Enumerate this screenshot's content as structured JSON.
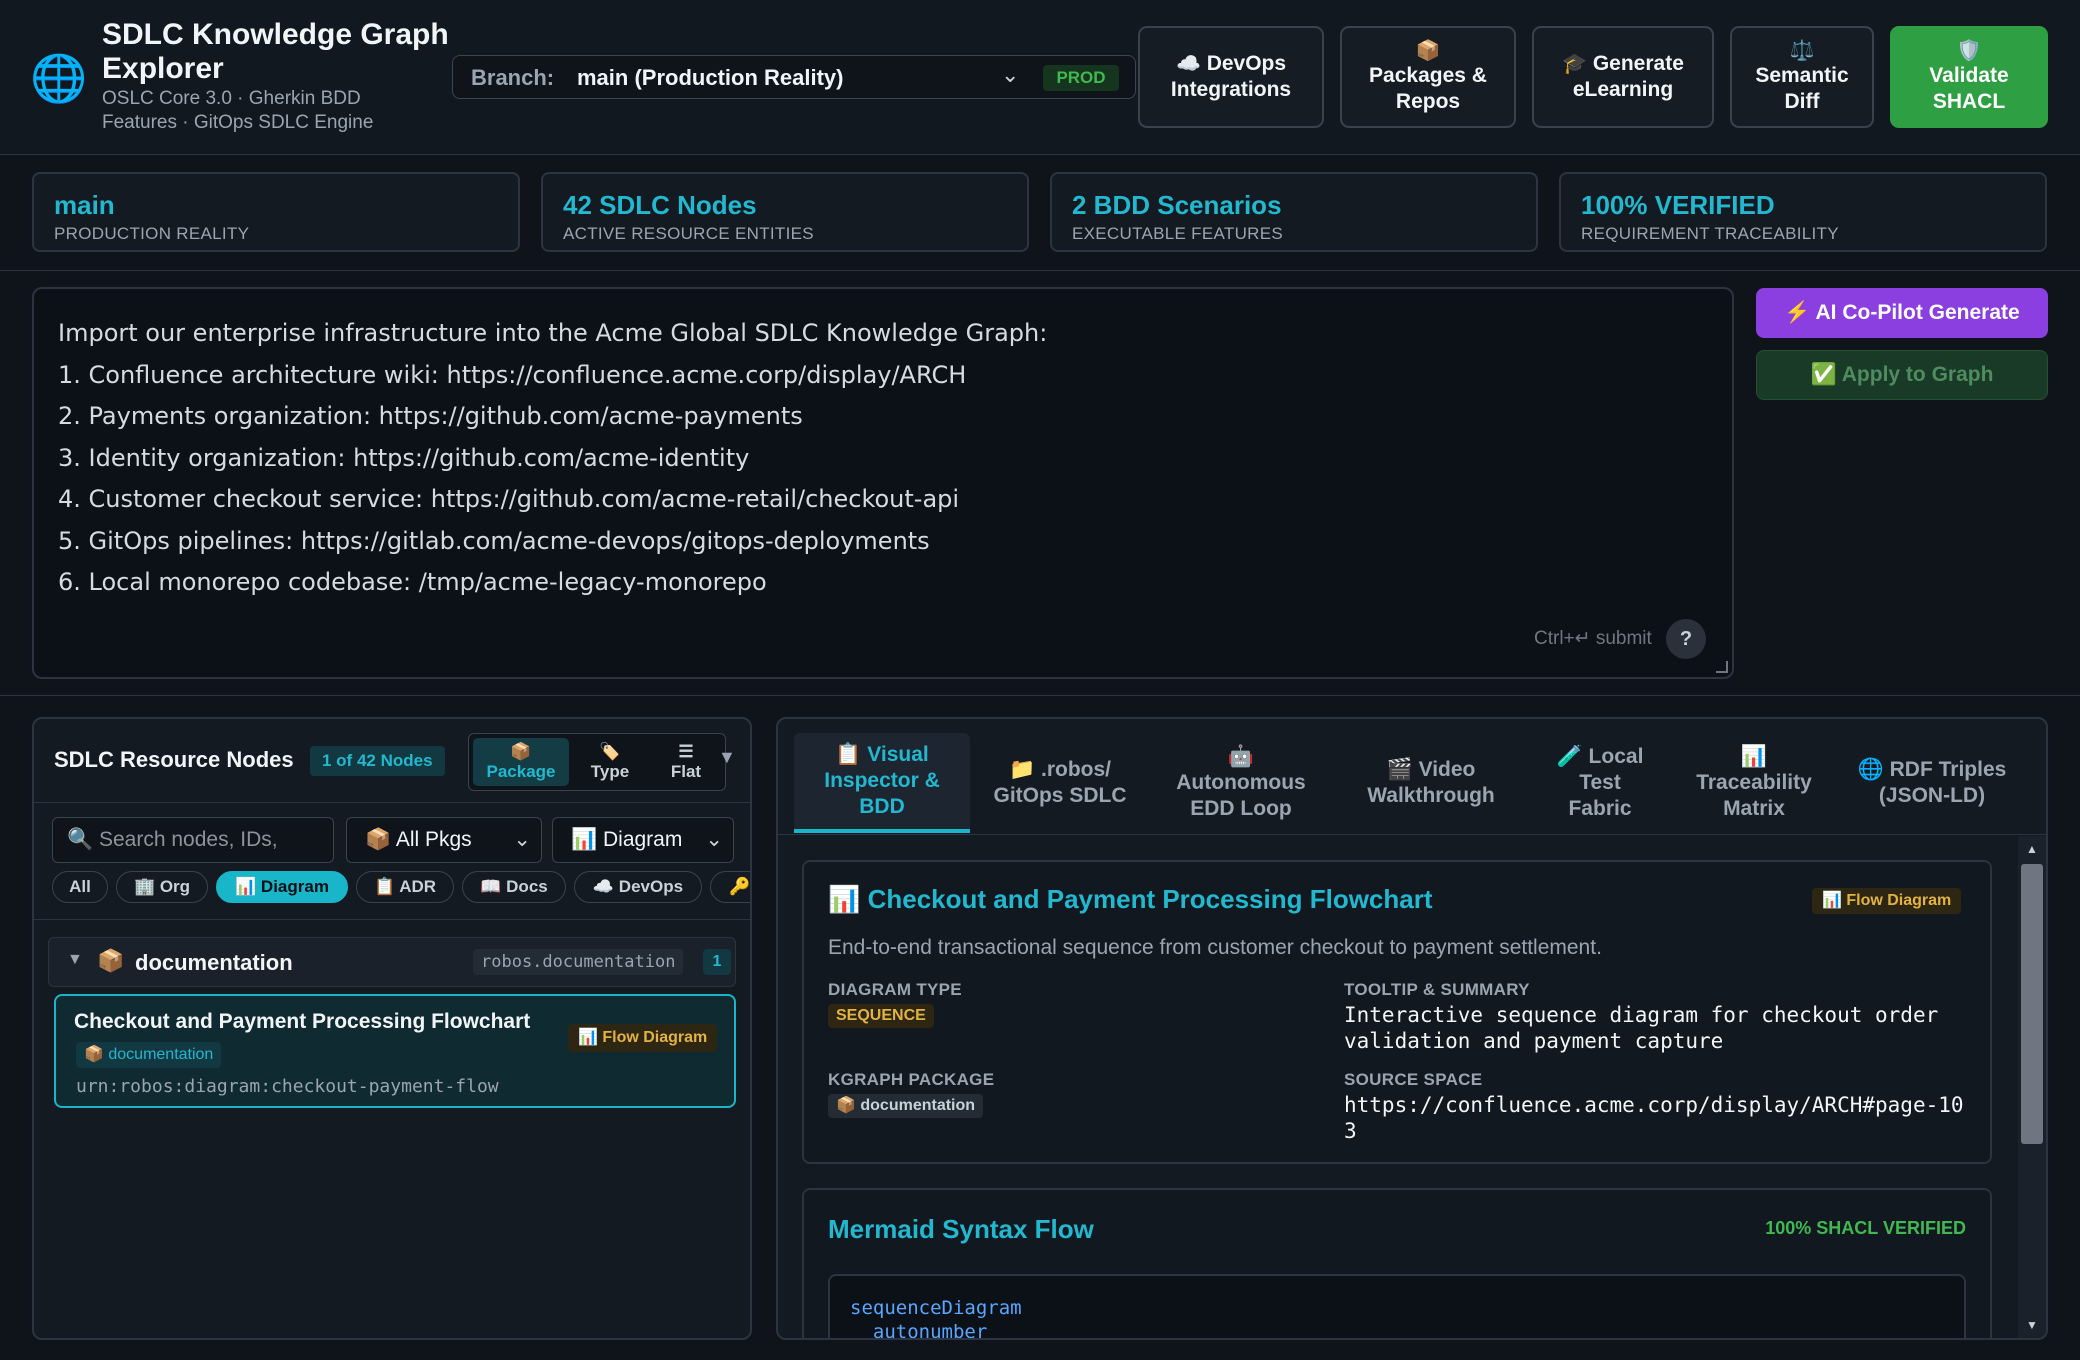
{
  "header": {
    "icon": "globe-icon",
    "title": "SDLC Knowledge Graph Explorer",
    "subtitle": "OSLC Core 3.0 · Gherkin BDD Features · GitOps SDLC Engine",
    "branch": {
      "label": "Branch:",
      "value": "main (Production Reality)",
      "badge": "PROD"
    },
    "buttons": [
      {
        "icon": "☁️",
        "label": "DevOps Integrations"
      },
      {
        "icon": "📦",
        "label": "Packages & Repos"
      },
      {
        "icon": "🎓",
        "label": "Generate eLearning"
      },
      {
        "icon": "⚖️",
        "label": "Semantic Diff"
      },
      {
        "icon": "🛡️",
        "label": "Validate SHACL"
      }
    ]
  },
  "stats": [
    {
      "value": "main",
      "label": "PRODUCTION REALITY"
    },
    {
      "value": "42 SDLC Nodes",
      "label": "ACTIVE RESOURCE ENTITIES"
    },
    {
      "value": "2 BDD Scenarios",
      "label": "EXECUTABLE FEATURES"
    },
    {
      "value": "100% VERIFIED",
      "label": "REQUIREMENT TRACEABILITY"
    }
  ],
  "prompt": {
    "lines": [
      "Import our enterprise infrastructure into the Acme Global SDLC Knowledge Graph:",
      "1. Confluence architecture wiki: https://confluence.acme.corp/display/ARCH",
      "2. Payments organization: https://github.com/acme-payments",
      "3. Identity organization: https://github.com/acme-identity",
      "4. Customer checkout service: https://github.com/acme-retail/checkout-api",
      "5. GitOps pipelines: https://gitlab.com/acme-devops/gitops-deployments",
      "6. Local monorepo codebase: /tmp/acme-legacy-monorepo"
    ],
    "hint": "Ctrl+↵ submit",
    "help": "?",
    "ai_button": "⚡ AI Co-Pilot Generate",
    "apply_button": "✅ Apply to Graph"
  },
  "left": {
    "title": "SDLC Resource Nodes",
    "count": "1 of 42 Nodes",
    "views": [
      {
        "icon": "📦",
        "label": "Package"
      },
      {
        "icon": "🏷️",
        "label": "Type"
      },
      {
        "icon": "☰",
        "label": "Flat"
      }
    ],
    "collapse": "▼",
    "search_placeholder": "🔍 Search nodes, IDs,",
    "pkg_filter": "📦 All Pkgs",
    "type_filter": "📊 Diagram",
    "chips": [
      "All",
      "🏢 Org",
      "📊 Diagram",
      "📋 ADR",
      "📖 Docs",
      "☁️ DevOps",
      "🔑"
    ],
    "group": {
      "arrow": "▼",
      "icon": "📦",
      "name": "documentation",
      "namespace": "robos.documentation",
      "count": "1"
    },
    "node": {
      "title": "Checkout and Payment Processing Flowchart",
      "type": "📊 Flow Diagram",
      "package": "📦 documentation",
      "urn": "urn:robos:diagram:checkout-payment-flow"
    }
  },
  "right": {
    "tabs": [
      {
        "label": "📋 Visual Inspector & BDD"
      },
      {
        "label": "📁 .robos/ GitOps SDLC"
      },
      {
        "label": "🤖 Autonomous EDD Loop"
      },
      {
        "label": "🎬 Video Walkthrough"
      },
      {
        "label": "🧪 Local Test Fabric"
      },
      {
        "label": "📊 Traceability Matrix"
      },
      {
        "label": "🌐 RDF Triples (JSON-LD)"
      }
    ],
    "detail": {
      "title": "📊 Checkout and Payment Processing Flowchart",
      "badge": "📊 Flow Diagram",
      "description": "End-to-end transactional sequence from customer checkout to payment settlement.",
      "diagram_type_label": "DIAGRAM TYPE",
      "diagram_type": "SEQUENCE",
      "tooltip_label": "TOOLTIP & SUMMARY",
      "tooltip": "Interactive sequence diagram for checkout order validation and payment capture",
      "package_label": "KGRAPH PACKAGE",
      "package": "📦 documentation",
      "source_label": "SOURCE SPACE",
      "source": "https://confluence.acme.corp/display/ARCH#page-103"
    },
    "mermaid": {
      "title": "Mermaid Syntax Flow",
      "badge": "100% SHACL VERIFIED",
      "code": [
        "sequenceDiagram",
        "  autonumber"
      ]
    },
    "scroll": {
      "up": "▲",
      "down": "▼"
    }
  },
  "colors": {
    "accent": "#22b8cf",
    "success": "#2ea043",
    "ai": "#8b3fe0",
    "warning": "#e3b341"
  }
}
